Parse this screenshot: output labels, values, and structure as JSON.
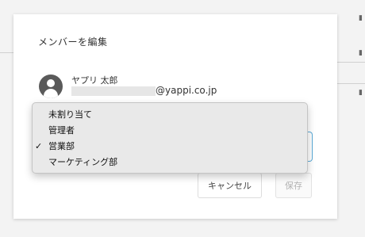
{
  "dialog": {
    "title": "メンバーを編集",
    "member": {
      "name": "ヤプリ 太郎",
      "email_domain": "@yappi.co.jp"
    },
    "role_dropdown": {
      "options": [
        "未割り当て",
        "管理者",
        "営業部",
        "マーケティング部"
      ],
      "selected_index": 2,
      "check_glyph": "✓"
    },
    "buttons": {
      "cancel": "キャンセル",
      "save": "保存"
    }
  }
}
